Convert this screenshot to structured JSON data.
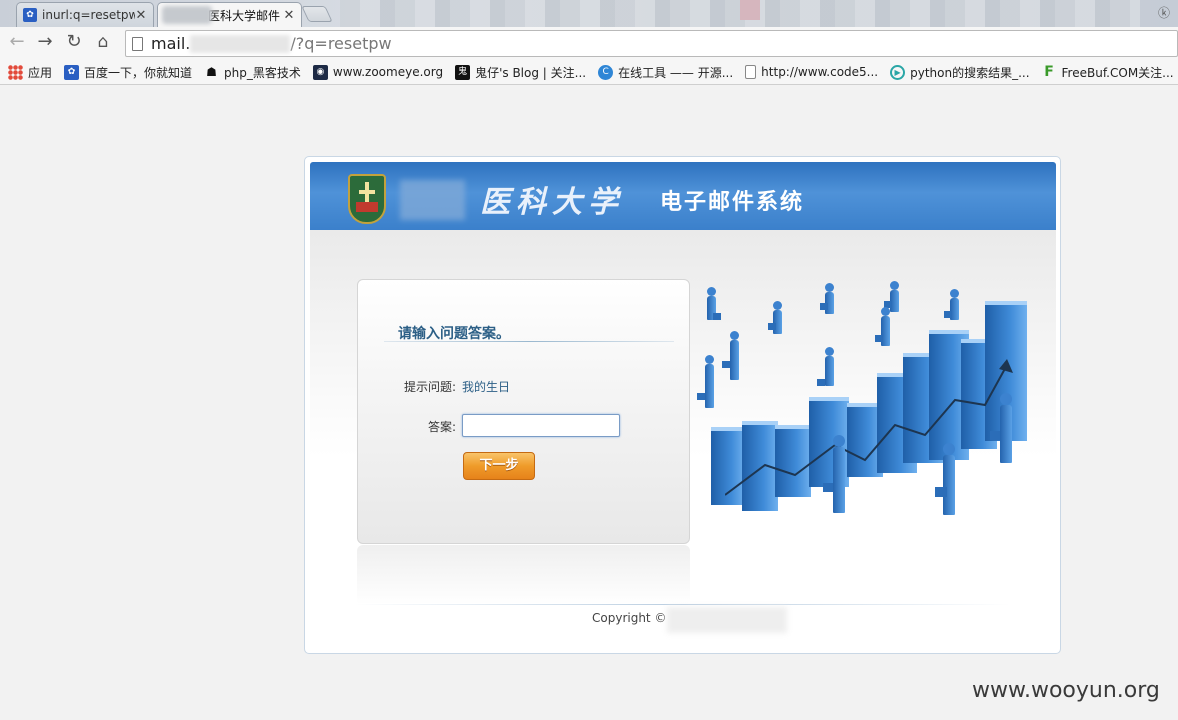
{
  "browser": {
    "tabs": [
      {
        "title": "inurl:q=resetpw",
        "active": false
      },
      {
        "title": "医科大学邮件",
        "active": true
      }
    ],
    "url_prefix": "mail.",
    "url_suffix": "/?q=resetpw",
    "nav_icons": [
      "back-icon",
      "forward-icon",
      "reload-icon",
      "home-icon"
    ],
    "bookmarks": [
      {
        "label": "应用",
        "icon": "apps-grid-icon"
      },
      {
        "label": "百度一下，你就知道",
        "icon": "baidu-paw-icon"
      },
      {
        "label": "php_黑客技术",
        "icon": "graduation-cap-icon"
      },
      {
        "label": "www.zoomeye.org",
        "icon": "zoomeye-eye-icon"
      },
      {
        "label": "鬼仔's Blog | 关注...",
        "icon": "ghost-blog-icon"
      },
      {
        "label": "在线工具 —— 开源...",
        "icon": "c-logo-icon"
      },
      {
        "label": "http://www.code5...",
        "icon": "page-icon"
      },
      {
        "label": "python的搜索结果_...",
        "icon": "play-circle-icon"
      },
      {
        "label": "FreeBuf.COM关注...",
        "icon": "freebuf-f-icon"
      }
    ]
  },
  "header": {
    "school_name": "医科大学",
    "system_title": "电子邮件系统"
  },
  "form": {
    "heading": "请输入问题答案。",
    "hint_label": "提示问题:",
    "hint_value": "我的生日",
    "answer_label": "答案:",
    "answer_value": "",
    "next_button": "下一步"
  },
  "footer": {
    "copyright": "Copyright ©"
  },
  "watermark": "www.wooyun.org",
  "colors": {
    "banner_blue": "#3b80cb",
    "heading_blue": "#2c5f86",
    "button_orange": "#ef9b2a"
  }
}
